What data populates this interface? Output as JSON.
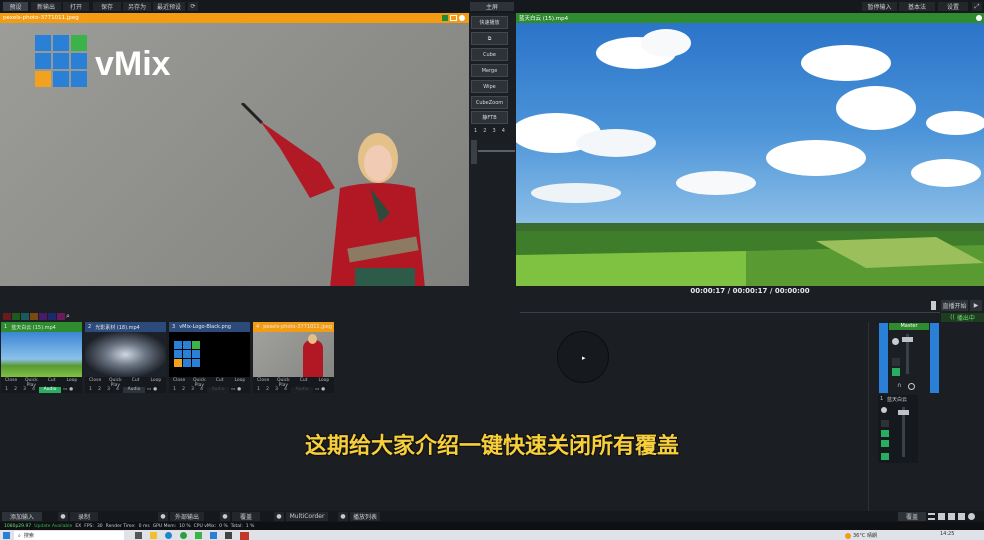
{
  "top_menu": {
    "items": [
      "预设",
      "新输出",
      "打开",
      "保存",
      "另存为",
      "最近预设"
    ],
    "right_items": [
      "暂停输入",
      "基本法",
      "设置"
    ],
    "main_label": "主屏"
  },
  "preview": {
    "title": "pexels-photo-3771011.jpeg",
    "logo_text": "vMix"
  },
  "output": {
    "title": "蓝天白云 (15).mp4",
    "timecode": "00:00:17  /  00:00:17  /  00:00:00",
    "record_label": "直播开始",
    "stream_label": "播出中"
  },
  "transitions": {
    "quick_play": "快速播放",
    "cut_icon": "cut-icon",
    "buttons": [
      "Cube",
      "Merge",
      "Wipe",
      "CubeZoom"
    ],
    "ftb": "静FTB",
    "nums": [
      "1",
      "2",
      "3",
      "4"
    ]
  },
  "colors": {
    "accent_orange": "#f39c12",
    "accent_green": "#2e8b2e",
    "card_blue": "#2c4a7a"
  },
  "inputs": [
    {
      "num": "1",
      "title": "蓝天白云 (15).mp4",
      "head_color": "#2e8b2e",
      "thumb": "sky"
    },
    {
      "num": "2",
      "title": "光影素材 (18).mp4",
      "head_color": "#2c4a7a",
      "thumb": "hall"
    },
    {
      "num": "3",
      "title": "vMix-Logo-Black.png",
      "head_color": "#2c4a7a",
      "thumb": "logo"
    },
    {
      "num": "4",
      "title": "pexels-photo-3771011.jpeg",
      "head_color": "#f39c12",
      "thumb": "teacher"
    }
  ],
  "card_controls": [
    "Close",
    "Quick Play",
    "Cut",
    "Loop"
  ],
  "card_audio": "Audio",
  "subtitle": "这期给大家介绍一键快速关闭所有覆盖",
  "mixer": {
    "master_label": "Master",
    "headphones_label": "headphones",
    "channel_label": "蓝天白云"
  },
  "bottom_bar": {
    "items": [
      "添加输入",
      "录制",
      "外部输出",
      "覆盖",
      "MultiCorder",
      "播放列表"
    ],
    "right_label": "覆盖"
  },
  "status_bar": {
    "resolution": "1080p29.97",
    "update": "Update Available",
    "ex": "EX",
    "fps_label": "FPS:",
    "fps": "30",
    "render_label": "Render Time:",
    "render": "0 ms",
    "gpu_label": "GPU Mem:",
    "gpu": "10 %",
    "cpu_label": "CPU vMix:",
    "cpu": "0 %",
    "total_label": "Total:",
    "total": "1 %"
  },
  "taskbar": {
    "search": "搜索",
    "weather": "36°C 晴朗",
    "time": "14:25"
  }
}
